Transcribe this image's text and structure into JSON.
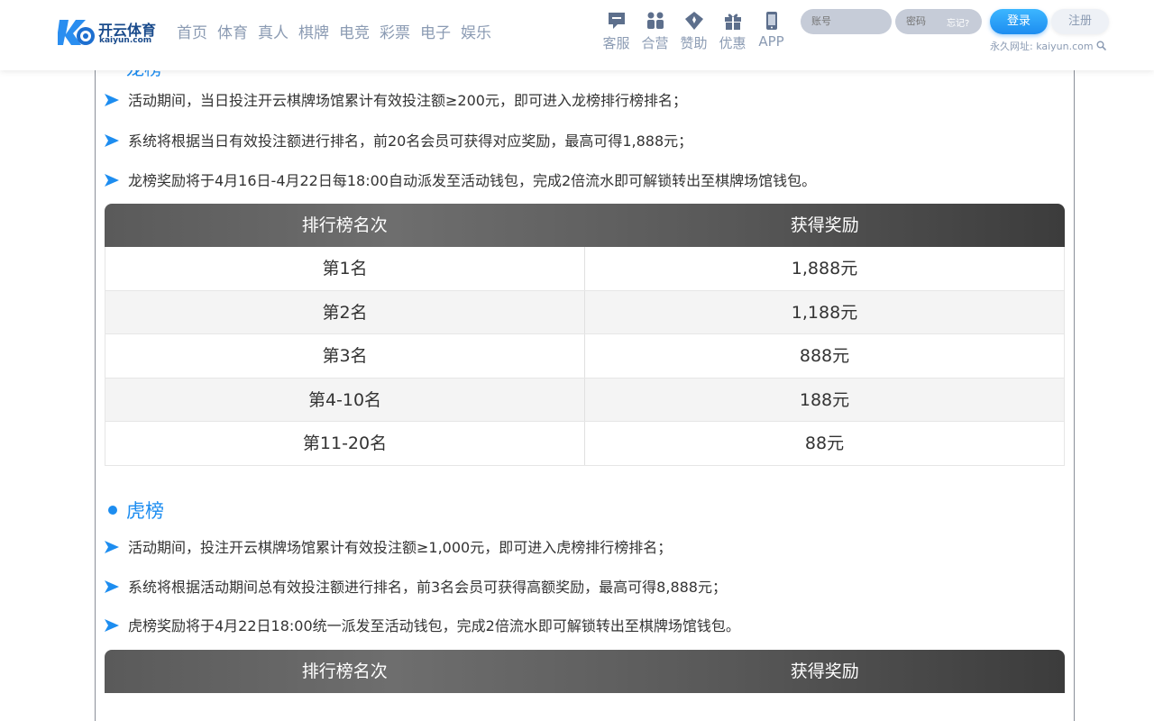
{
  "header": {
    "logo": {
      "title": "开云体育",
      "subtitle": "kaiyun.com"
    },
    "nav": [
      "首页",
      "体育",
      "真人",
      "棋牌",
      "电竞",
      "彩票",
      "电子",
      "娱乐"
    ],
    "tools": [
      {
        "icon": "chat-icon",
        "label": "客服"
      },
      {
        "icon": "partners-icon",
        "label": "合营"
      },
      {
        "icon": "sponsor-icon",
        "label": "赞助"
      },
      {
        "icon": "gift-icon",
        "label": "优惠"
      },
      {
        "icon": "phone-icon",
        "label": "APP"
      }
    ],
    "login": {
      "account_placeholder": "账号",
      "password_placeholder": "密码",
      "forgot": "忘记?",
      "login_label": "登录",
      "register_label": "注册",
      "permanent_url": "永久网址: kaiyun.com"
    }
  },
  "content": {
    "dragon": {
      "title_cut": "龙榜",
      "rules": [
        "活动期间，当日投注开云棋牌场馆累计有效投注额≥200元，即可进入龙榜排行榜排名；",
        "系统将根据当日有效投注额进行排名，前20名会员可获得对应奖励，最高可得1,888元；",
        "龙榜奖励将于4月16日-4月22日每18:00自动派发至活动钱包，完成2倍流水即可解锁转出至棋牌场馆钱包。"
      ],
      "table": {
        "headers": [
          "排行榜名次",
          "获得奖励"
        ],
        "rows": [
          [
            "第1名",
            "1,888元"
          ],
          [
            "第2名",
            "1,188元"
          ],
          [
            "第3名",
            "888元"
          ],
          [
            "第4-10名",
            "188元"
          ],
          [
            "第11-20名",
            "88元"
          ]
        ]
      }
    },
    "tiger": {
      "title": "虎榜",
      "rules": [
        "活动期间，投注开云棋牌场馆累计有效投注额≥1,000元，即可进入虎榜排行榜排名；",
        "系统将根据活动期间总有效投注额进行排名，前3名会员可获得高额奖励，最高可得8,888元；",
        "虎榜奖励将于4月22日18:00统一派发至活动钱包，完成2倍流水即可解锁转出至棋牌场馆钱包。"
      ],
      "table": {
        "headers": [
          "排行榜名次",
          "获得奖励"
        ]
      }
    }
  },
  "colors": {
    "accent": "#1d8df0",
    "nav_text": "#8b9bb3",
    "table_header": "#4f4f4f"
  }
}
